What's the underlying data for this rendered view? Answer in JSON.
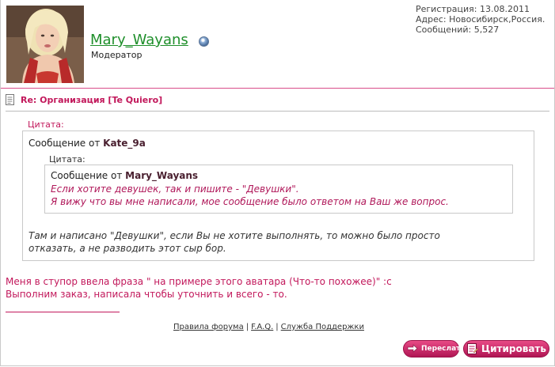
{
  "user": {
    "name": "Mary_Wayans",
    "role": "Модератор",
    "registration": "Регистрация: 13.08.2011",
    "address": "Адрес: Новосибирск,Россия.",
    "messages": "Сообщений: 5,527"
  },
  "post": {
    "title": "Re: Организация [Te Quiero]",
    "outer_quote": {
      "label": "Цитата:",
      "from_prefix": "Сообщение от",
      "from_author": "Kate_9a",
      "inner_quote": {
        "label": "Цитата:",
        "from_prefix": "Сообщение от",
        "from_author": "Mary_Wayans",
        "lines": [
          "Если хотите девушек, так и пишите - \"Девушки\".",
          "Я вижу что вы мне написали, мое сообщение было ответом на Ваш же вопрос."
        ]
      },
      "lines": [
        "Там и написано \"Девушки\", если Вы не хотите выполнять, то можно было просто",
        "отказать, а не разводить этот сыр бор."
      ]
    },
    "message_lines": [
      "Меня в ступор ввела фраза \" на примере этого аватара (Что-то похожее)\" :с",
      "Выполним заказ, написала чтобы уточнить и всего - то."
    ]
  },
  "footer": {
    "rules": "Правила форума",
    "faq": "F.A.Q.",
    "support": "Служба Поддержки",
    "separator": "|"
  },
  "buttons": {
    "forward": "Переслать",
    "quote": "Цитировать"
  },
  "colors": {
    "accent": "#c2185b",
    "username": "#1f8f2b",
    "button": "#d0306f"
  }
}
